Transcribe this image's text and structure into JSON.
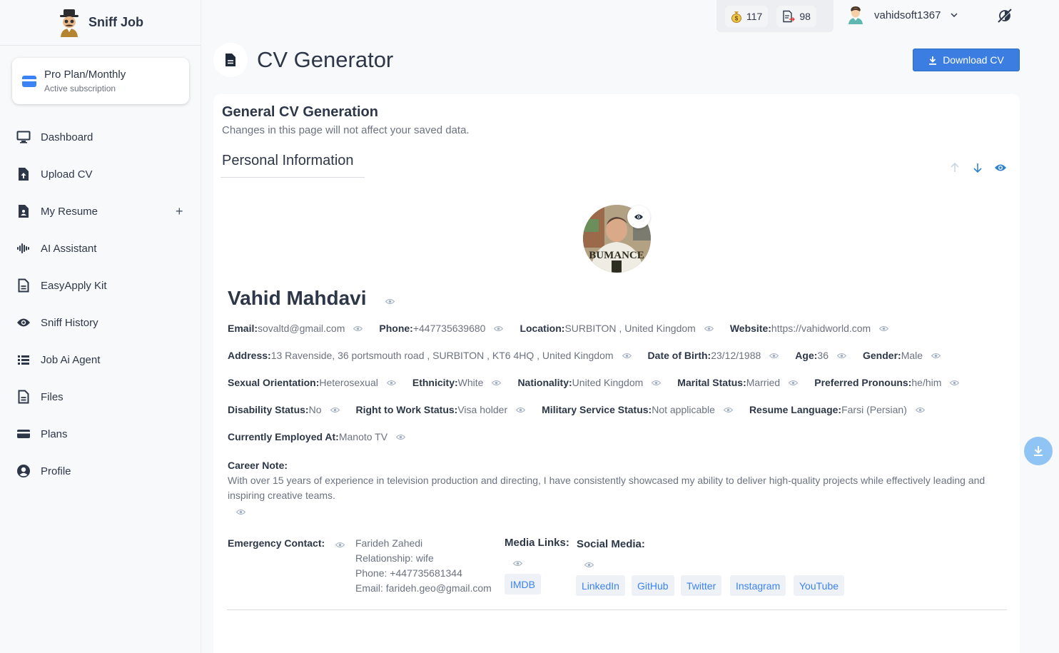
{
  "brand": {
    "name": "Sniff Job"
  },
  "plan": {
    "title": "Pro Plan/Monthly",
    "subtitle": "Active subscription"
  },
  "nav": [
    {
      "label": "Dashboard",
      "icon": "monitor-icon"
    },
    {
      "label": "Upload CV",
      "icon": "file-upload-icon"
    },
    {
      "label": "My Resume",
      "icon": "resume-icon",
      "extra": "+"
    },
    {
      "label": "AI Assistant",
      "icon": "waveform-icon"
    },
    {
      "label": "EasyApply Kit",
      "icon": "document-icon"
    },
    {
      "label": "Sniff History",
      "icon": "eye-icon"
    },
    {
      "label": "Job Ai Agent",
      "icon": "list-icon"
    },
    {
      "label": "Files",
      "icon": "file-icon"
    },
    {
      "label": "Plans",
      "icon": "credit-card-icon"
    },
    {
      "label": "Profile",
      "icon": "user-circle-icon"
    }
  ],
  "topbar": {
    "coins": "117",
    "credits": "98",
    "username": "vahidsoft1367"
  },
  "header": {
    "title": "CV Generator",
    "download_label": "Download CV"
  },
  "card": {
    "title": "General CV Generation",
    "subtitle": "Changes in this page will not affect your saved data.",
    "section": "Personal Information"
  },
  "person": {
    "name": "Vahid Mahdavi",
    "rows": [
      [
        {
          "label": "Email:",
          "value": "sovaltd@gmail.com"
        },
        {
          "label": "Phone:",
          "value": "+447735639680"
        },
        {
          "label": "Location:",
          "value": "SURBITON , United Kingdom"
        },
        {
          "label": "Website:",
          "value": "https://vahidworld.com"
        }
      ],
      [
        {
          "label": "Address:",
          "value": "13 Ravenside, 36 portsmouth road , SURBITON , KT6 4HQ , United Kingdom"
        },
        {
          "label": "Date of Birth:",
          "value": "23/12/1988"
        },
        {
          "label": "Age:",
          "value": "36"
        },
        {
          "label": "Gender:",
          "value": "Male"
        }
      ],
      [
        {
          "label": "Sexual Orientation:",
          "value": "Heterosexual"
        },
        {
          "label": "Ethnicity:",
          "value": "White"
        },
        {
          "label": "Nationality:",
          "value": "United Kingdom"
        },
        {
          "label": "Marital Status:",
          "value": "Married"
        },
        {
          "label": "Preferred Pronouns:",
          "value": "he/him"
        }
      ],
      [
        {
          "label": "Disability Status:",
          "value": "No"
        },
        {
          "label": "Right to Work Status:",
          "value": "Visa holder"
        },
        {
          "label": "Military Service Status:",
          "value": "Not applicable"
        },
        {
          "label": "Resume Language:",
          "value": "Farsi (Persian)"
        }
      ],
      [
        {
          "label": "Currently Employed At:",
          "value": "Manoto TV"
        }
      ]
    ],
    "career_label": "Career Note:",
    "career_text": "With over 15 years of experience in television production and directing, I have consistently showcased my ability to deliver high-quality projects while effectively leading and inspiring creative teams.",
    "emergency": {
      "label": "Emergency Contact:",
      "name": "Farideh Zahedi",
      "relationship": "Relationship: wife",
      "phone": "Phone: +447735681344",
      "email": "Email: farideh.geo@gmail.com"
    },
    "media_links_label": "Media Links:",
    "media_links": [
      "IMDB"
    ],
    "social_label": "Social Media:",
    "social": [
      "LinkedIn",
      "GitHub",
      "Twitter",
      "Instagram",
      "YouTube"
    ]
  },
  "colors": {
    "accent": "#3b7de0",
    "chip_bg": "#eef2f7",
    "chip_text": "#3b82f6"
  }
}
